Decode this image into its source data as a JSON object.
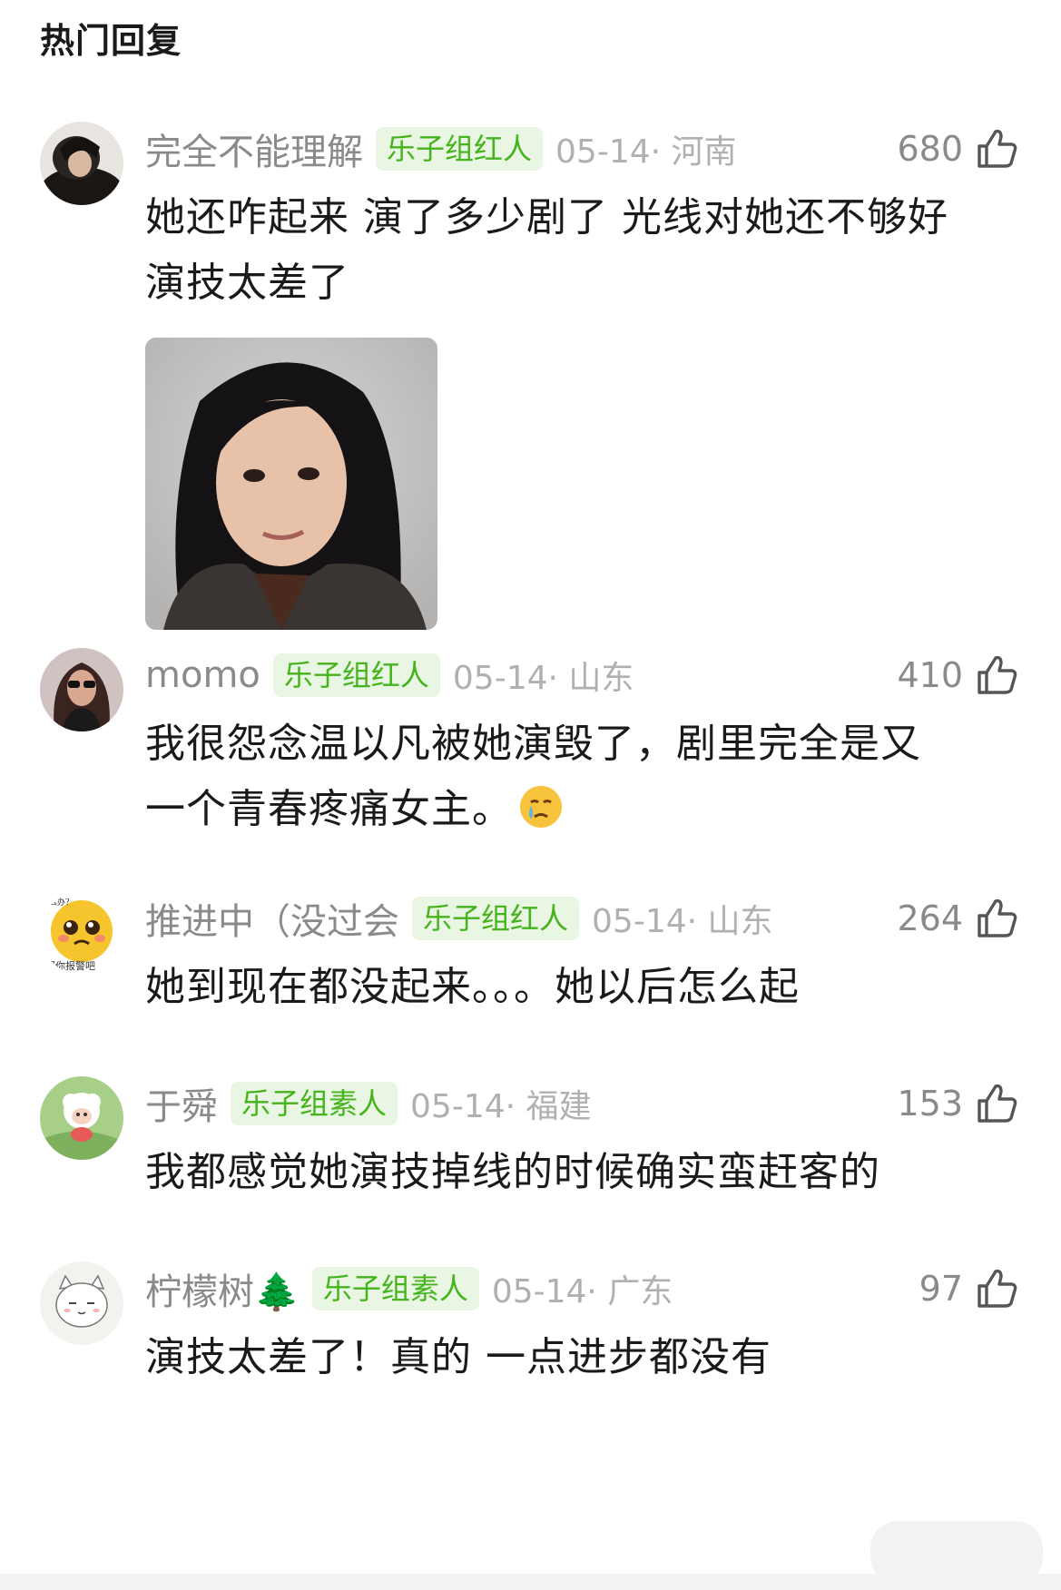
{
  "section_title": "热门回复",
  "colors": {
    "badge_bg": "#eaf6e4",
    "badge_text": "#45b41c",
    "username": "#8a8a8a",
    "timestamp": "#b0b0b0",
    "comment_text": "#1a1a1a"
  },
  "comments": [
    {
      "username": "完全不能理解",
      "badge": "乐子组红人",
      "timestamp": "05-14· 河南",
      "likes": "680",
      "lines": [
        "她还咋起来 演了多少剧了 光线对她还不够好",
        "演技太差了"
      ],
      "has_image": true,
      "avatar_icon": "dark-hair-person-avatar"
    },
    {
      "username": "momo",
      "badge": "乐子组红人",
      "timestamp": "05-14· 山东",
      "likes": "410",
      "lines": [
        "我很怨念温以凡被她演毁了，剧里完全是又",
        "一个青春疼痛女主。"
      ],
      "emoji_icon": "crying-face-emoji",
      "avatar_icon": "woman-sunglasses-avatar"
    },
    {
      "username": "推进中（没过会",
      "badge": "乐子组红人",
      "timestamp": "05-14· 山东",
      "likes": "264",
      "lines": [
        "她到现在都没起来。。。她以后怎么起"
      ],
      "avatar_icon": "pleading-face-sticker-avatar",
      "avatar_text_top": "么办？",
      "avatar_text_bottom": "那你报警吧"
    },
    {
      "username": "于舜",
      "badge": "乐子组素人",
      "timestamp": "05-14· 福建",
      "likes": "153",
      "lines": [
        "我都感觉她演技掉线的时候确实蛮赶客的"
      ],
      "avatar_icon": "cartoon-sheep-avatar"
    },
    {
      "username": "柠檬树🌲",
      "badge": "乐子组素人",
      "timestamp": "05-14· 广东",
      "likes": "97",
      "lines": [
        "演技太差了！真的 一点进步都没有"
      ],
      "avatar_icon": "cartoon-cat-avatar"
    }
  ]
}
